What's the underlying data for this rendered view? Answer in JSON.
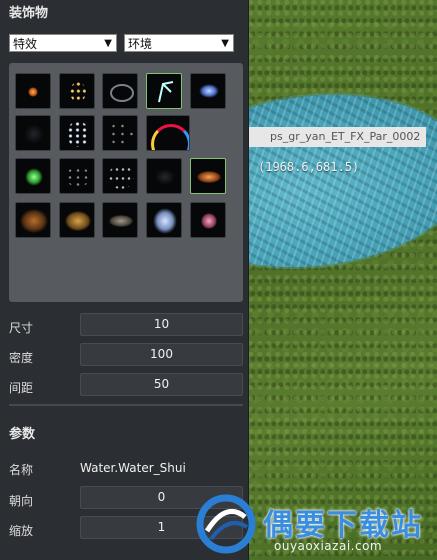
{
  "scene": {
    "tooltip_text": "ps_gr_yan_ET_FX_Par_0002",
    "coordinates": "(1968.6,681.5)"
  },
  "decorations": {
    "title": "装饰物",
    "type_select": "特效",
    "category_select": "环境",
    "thumbnails": [
      "orange-flare",
      "sparkle-dust",
      "ring-vortex",
      "cyan-beam",
      "blue-spark",
      "dark-mist",
      "white-sparks",
      "faint-stars",
      "rainbow-arc",
      "",
      "green-glow",
      "dim-dust",
      "scatter-stars",
      "dark-smoke",
      "fire-swirl",
      "brown-smoke",
      "golden-dust",
      "grey-cloud",
      "blue-smoke",
      "pink-bloom"
    ],
    "selected_index": 13
  },
  "brush": {
    "size_label": "尺寸",
    "size_value": "10",
    "density_label": "密度",
    "density_value": "100",
    "spacing_label": "间距",
    "spacing_value": "50"
  },
  "params": {
    "title": "参数",
    "name_label": "名称",
    "name_value": "Water.Water_Shui",
    "facing_label": "朝向",
    "facing_value": "0",
    "scale_label": "缩放",
    "scale_value": "1"
  },
  "watermark": {
    "brand": "偶要下载站",
    "domain": "ouyaoxiazai.com"
  }
}
